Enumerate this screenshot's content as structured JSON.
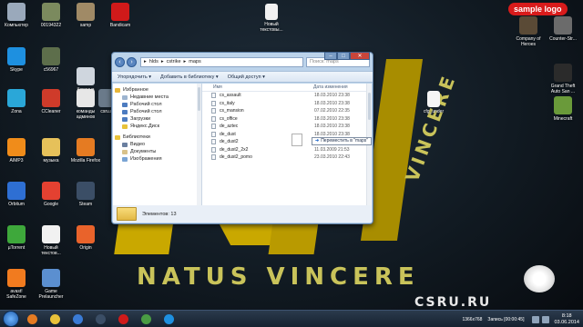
{
  "wallpaper": {
    "text": "NATUS VINCERE",
    "text_vertical": "VINCERE",
    "csru": "CSRU.RU"
  },
  "logo_badge": "sample logo",
  "desktop_icons_left": [
    {
      "label": "Компьютер",
      "color": "#9aa9bb"
    },
    {
      "label": "00194322",
      "color": "#7b8a5e"
    },
    {
      "label": "samp",
      "color": "#a08a66"
    },
    {
      "label": "Bandicam",
      "color": "#d01a1a"
    },
    {
      "label": "Skype",
      "color": "#1e90e0"
    },
    {
      "label": "c56967",
      "color": "#5d6e4b"
    },
    {
      "label": "Корзина",
      "color": "#cfd6de"
    },
    {
      "label": "Zona",
      "color": "#2aa7d8"
    },
    {
      "label": "CCleaner",
      "color": "#cf3b2a"
    },
    {
      "label": "команды админов",
      "color": "#e7e7e7"
    },
    {
      "label": "AIMP3",
      "color": "#f08c1a"
    },
    {
      "label": "музыка",
      "color": "#e6c15a"
    },
    {
      "label": "Mozilla Firefox",
      "color": "#e57b22"
    },
    {
      "label": "Orbitum",
      "color": "#2e6fd3"
    },
    {
      "label": "Google",
      "color": "#e44131"
    },
    {
      "label": "Steam",
      "color": "#3b4e66"
    },
    {
      "label": "µTorrent",
      "color": "#3ea83b"
    },
    {
      "label": "Новый текстов...",
      "color": "#f1f1f1"
    },
    {
      "label": "Origin",
      "color": "#e9632b"
    },
    {
      "label": "avast! SafeZone",
      "color": "#f17b1f"
    },
    {
      "label": "Game Prelauncher",
      "color": "#5b8fd0"
    },
    {
      "label": "csru.ru",
      "color": "#6a7a8a"
    }
  ],
  "desktop_icons_top": [
    {
      "label": "Новый текстовы...",
      "color": "#f1f1f1"
    }
  ],
  "desktop_icons_right": [
    {
      "label": "Company of Heroes",
      "color": "#5a4a36"
    },
    {
      "label": "Counter-Str...",
      "color": "#6b6b6b"
    },
    {
      "label": "Grand Theft Auto San ...",
      "color": "#2b2b2b"
    },
    {
      "label": "Minecraft",
      "color": "#6a9a3a"
    }
  ],
  "desktop_icon_middle": {
    "label": "cfg_under",
    "color": "#f5f5f5"
  },
  "explorer": {
    "breadcrumb": [
      "hlds",
      "cstrike",
      "maps"
    ],
    "search_placeholder": "Поиск: maps",
    "window_controls": {
      "minimize": "–",
      "maximize": "□",
      "close": "✕"
    },
    "toolbar": [
      "Упорядочить ▾",
      "Добавить в библиотеку ▾",
      "Общий доступ ▾"
    ],
    "nav_items": [
      {
        "label": "Избранное",
        "sub": false,
        "color": "#e8b73a"
      },
      {
        "label": "Недавние места",
        "sub": true,
        "color": "#9db4cf"
      },
      {
        "label": "Рабочий стол",
        "sub": true,
        "color": "#4d7cc0"
      },
      {
        "label": "Рабочий стол",
        "sub": true,
        "color": "#4d7cc0"
      },
      {
        "label": "Загрузки",
        "sub": true,
        "color": "#4d7cc0"
      },
      {
        "label": "Яндекс.Диск",
        "sub": true,
        "color": "#e8c23a"
      },
      {
        "label": "",
        "sub": false,
        "color": "transparent"
      },
      {
        "label": "Библиотеки",
        "sub": false,
        "color": "#e8c23a"
      },
      {
        "label": "Видео",
        "sub": true,
        "color": "#6a7fa0"
      },
      {
        "label": "Документы",
        "sub": true,
        "color": "#d9c28a"
      },
      {
        "label": "Изображения",
        "sub": true,
        "color": "#7aa4d4"
      }
    ],
    "columns": {
      "name": "Имя",
      "date": "Дата изменения"
    },
    "files": [
      {
        "name": "cs_assault",
        "date": "18.03.2010 23:38"
      },
      {
        "name": "cs_italy",
        "date": "18.03.2010 23:38"
      },
      {
        "name": "cs_mansion",
        "date": "07.02.2010 22:35"
      },
      {
        "name": "cs_office",
        "date": "18.03.2010 23:38"
      },
      {
        "name": "de_aztec",
        "date": "18.03.2010 23:38"
      },
      {
        "name": "de_dust",
        "date": "18.03.2010 23:38"
      },
      {
        "name": "de_dust2",
        "date": "18.03.2010 23:38"
      },
      {
        "name": "de_dust2_2x2",
        "date": "11.03.2009 21:53"
      },
      {
        "name": "de_dust2_pomo",
        "date": "23.03.2010 22:43"
      }
    ],
    "status": "Элементов: 13"
  },
  "drag_tooltip": {
    "arrow": "➜",
    "text": "Переместить в \"maps\""
  },
  "taskbar": {
    "apps": [
      {
        "name": "Firefox",
        "color": "#e57b22"
      },
      {
        "name": "Explorer",
        "color": "#e8c23a"
      },
      {
        "name": "Media",
        "color": "#3a7bd5"
      },
      {
        "name": "Steam",
        "color": "#3b4e66"
      },
      {
        "name": "Bandicam",
        "color": "#d01a1a"
      },
      {
        "name": "Chrome",
        "color": "#4a9c44"
      },
      {
        "name": "Skype",
        "color": "#1e90e0"
      }
    ],
    "recording_res": "1366x768",
    "recording_time": "Запись [00:00:45]",
    "time": "8:18",
    "date": "03.06.2014"
  }
}
